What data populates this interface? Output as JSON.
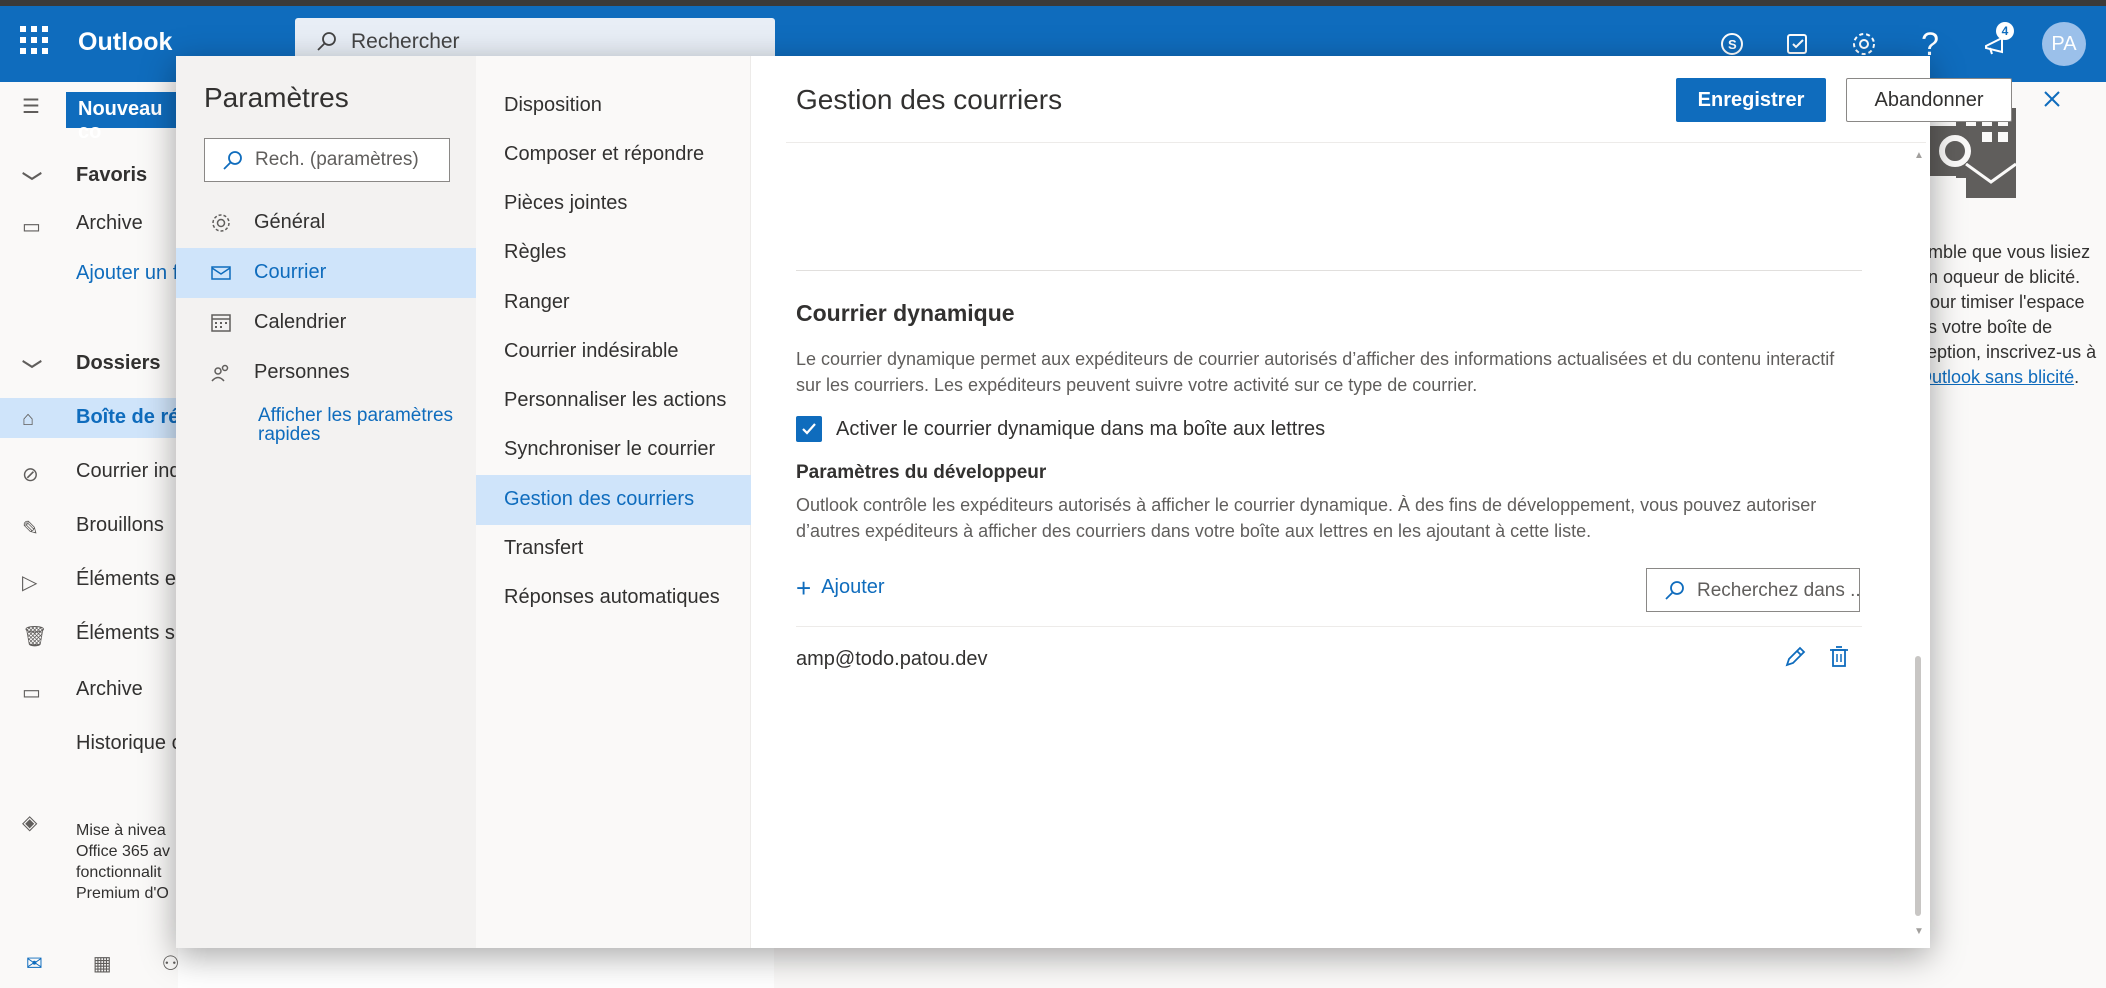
{
  "app": {
    "brand": "Outlook",
    "search_placeholder": "Rechercher",
    "notifications_count": "4",
    "avatar_initials": "PA"
  },
  "leftnav": {
    "new_mail": "Nouveau co",
    "items": [
      {
        "label": "Favoris",
        "icon": "chevron-down-icon"
      },
      {
        "label": "Archive",
        "icon": "archive-icon"
      },
      {
        "label": "Ajouter un f",
        "icon": ""
      },
      {
        "label": "Dossiers",
        "icon": "chevron-down-icon"
      },
      {
        "label": "Boîte de réc",
        "icon": "inbox-icon"
      },
      {
        "label": "Courrier ind",
        "icon": "block-icon"
      },
      {
        "label": "Brouillons",
        "icon": "pencil-icon"
      },
      {
        "label": "Éléments en",
        "icon": "send-icon"
      },
      {
        "label": "Éléments su",
        "icon": "trash-icon"
      },
      {
        "label": "Archive",
        "icon": "archive-icon"
      },
      {
        "label": "Historique c",
        "icon": ""
      }
    ],
    "upgrade_lines": [
      "Mise à nivea",
      "Office 365 av",
      "fonctionnalit",
      "Premium d'O"
    ]
  },
  "ad": {
    "text": "emble que vous lisiez un oqueur de blicité. Pour timiser l'espace ns votre boîte de ception, inscrivez-us à ",
    "link": "Outlook sans blicité",
    "end": "."
  },
  "settings": {
    "title": "Paramètres",
    "search_placeholder": "Rech. (paramètres)",
    "categories": [
      {
        "label": "Général",
        "icon": "gear-icon"
      },
      {
        "label": "Courrier",
        "icon": "mail-icon"
      },
      {
        "label": "Calendrier",
        "icon": "calendar-icon"
      },
      {
        "label": "Personnes",
        "icon": "people-icon"
      }
    ],
    "quick_settings_link": "Afficher les paramètres rapides",
    "subcategories": [
      "Disposition",
      "Composer et répondre",
      "Pièces jointes",
      "Règles",
      "Ranger",
      "Courrier indésirable",
      "Personnaliser les actions",
      "Synchroniser le courrier",
      "Gestion des courriers",
      "Transfert",
      "Réponses automatiques"
    ]
  },
  "pane": {
    "title": "Gestion des courriers",
    "save": "Enregistrer",
    "discard": "Abandonner",
    "section_title": "Courrier dynamique",
    "section_desc": "Le courrier dynamique permet aux expéditeurs de courrier autorisés d’afficher des informations actualisées et du contenu interactif sur les courriers. Les expéditeurs peuvent suivre votre activité sur ce type de courrier.",
    "checkbox_label": "Activer le courrier dynamique dans ma boîte aux lettres",
    "checkbox_checked": true,
    "dev_title": "Paramètres du développeur",
    "dev_desc": "Outlook contrôle les expéditeurs autorisés à afficher le courrier dynamique. À des fins de développement, vous pouvez autoriser d’autres expéditeurs à afficher des courriers dans votre boîte aux lettres en les ajoutant à cette liste.",
    "add_label": "Ajouter",
    "list_search_placeholder": "Recherchez dans ...",
    "senders": [
      "amp@todo.patou.dev"
    ]
  },
  "colors": {
    "accent": "#0f6cbd",
    "selected_bg": "#cfe4fa"
  }
}
